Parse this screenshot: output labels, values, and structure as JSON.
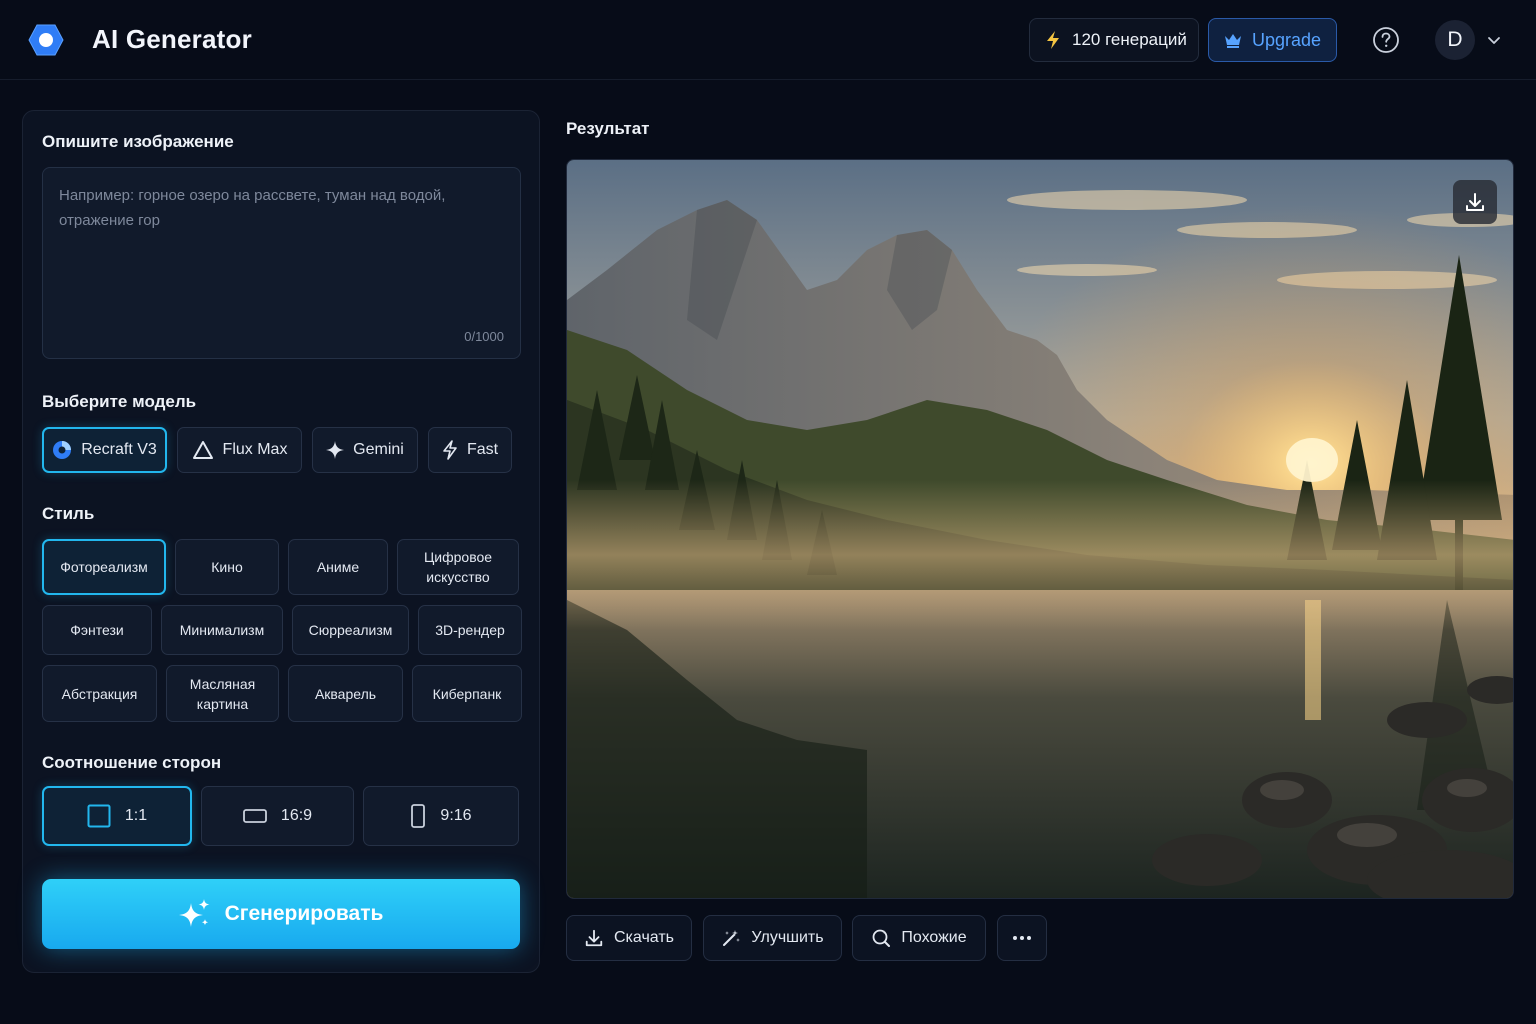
{
  "header": {
    "app_title": "AI Generator",
    "credits_label": "120 генераций",
    "upgrade_label": "Upgrade",
    "avatar_initial": "D",
    "icons": {
      "logo": "hexagon-logo-icon",
      "credits": "lightning-icon",
      "upgrade": "crown-icon",
      "help": "help-icon",
      "menu": "chevron-down-icon"
    },
    "colors": {
      "accent": "#22b7ee",
      "upgrade": "#57a3ff"
    }
  },
  "prompt": {
    "title": "Опишите изображение",
    "placeholder": "Например: горное озеро на рассвете, туман над водой, отражение гор",
    "value": "",
    "counter": "0/1000"
  },
  "model": {
    "title": "Выберите модель",
    "options": [
      {
        "label": "Recraft V3",
        "icon": "recraft-icon",
        "active": true
      },
      {
        "label": "Flux Max",
        "icon": "triangle-icon",
        "active": false
      },
      {
        "label": "Gemini",
        "icon": "sparkle-icon",
        "active": false
      },
      {
        "label": "Fast",
        "icon": "lightning-icon",
        "active": false
      }
    ]
  },
  "style": {
    "title": "Стиль",
    "options": [
      {
        "label": "Фотореализм",
        "active": true
      },
      {
        "label": "Кино",
        "active": false
      },
      {
        "label": "Аниме",
        "active": false
      },
      {
        "label": "Цифровое искусство",
        "active": false
      },
      {
        "label": "Фэнтези",
        "active": false
      },
      {
        "label": "Минимализм",
        "active": false
      },
      {
        "label": "Сюрреализм",
        "active": false
      },
      {
        "label": "3D-рендер",
        "active": false
      },
      {
        "label": "Абстракция",
        "active": false
      },
      {
        "label": "Масляная картина",
        "active": false
      },
      {
        "label": "Акварель",
        "active": false
      },
      {
        "label": "Киберпанк",
        "active": false
      }
    ]
  },
  "aspect": {
    "title": "Соотношение сторон",
    "options": [
      {
        "label": "1:1",
        "icon": "square-icon",
        "active": true
      },
      {
        "label": "16:9",
        "icon": "landscape-rect-icon",
        "active": false
      },
      {
        "label": "9:16",
        "icon": "portrait-rect-icon",
        "active": false
      }
    ]
  },
  "generate_label": "Сгенерировать",
  "result": {
    "title": "Результат",
    "actions": [
      {
        "label": "Скачать",
        "icon": "download-icon"
      },
      {
        "label": "Улучшить",
        "icon": "magic-wand-icon"
      },
      {
        "label": "Похожие",
        "icon": "similar-search-icon"
      },
      {
        "label": "",
        "icon": "more-icon"
      }
    ]
  }
}
